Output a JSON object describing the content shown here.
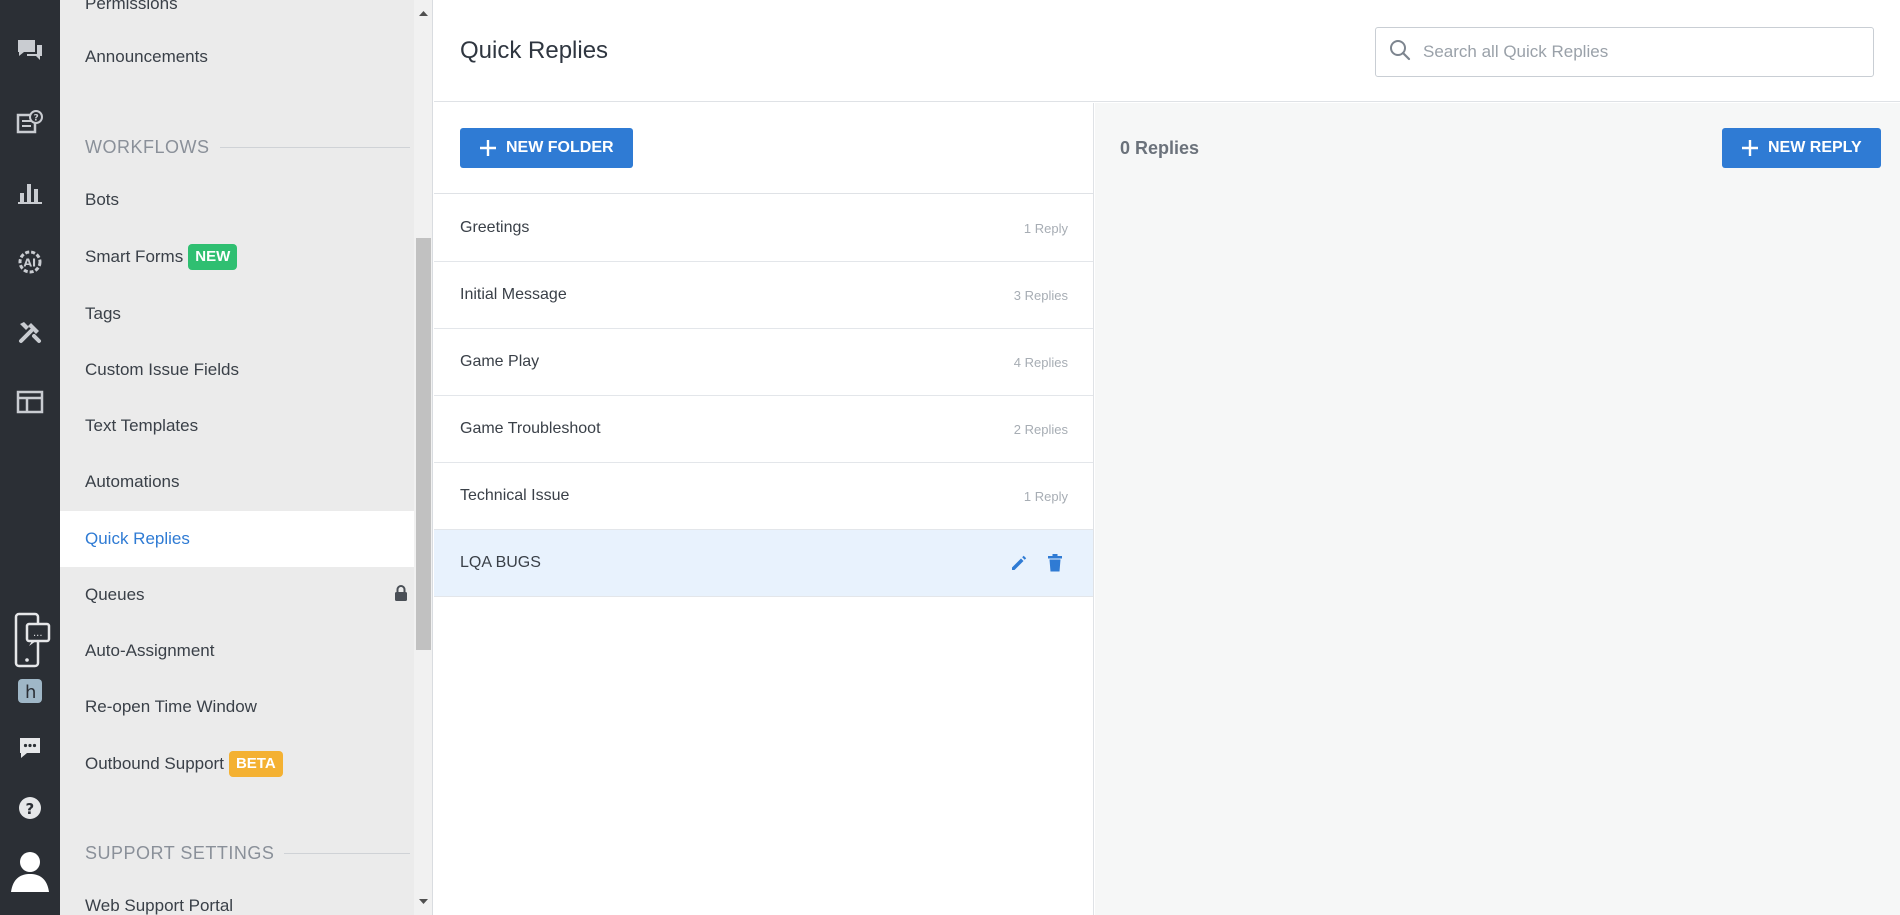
{
  "rail": {
    "icons": [
      "conversations-icon",
      "help-articles-icon",
      "analytics-icon",
      "ai-icon",
      "settings-tools-icon",
      "layout-icon",
      "mobile-chat-icon",
      "helpshift-logo-icon",
      "chat-icon",
      "help-icon",
      "profile-avatar-icon"
    ]
  },
  "sidebar": {
    "top_items": [
      {
        "label": "Permissions"
      },
      {
        "label": "Announcements"
      }
    ],
    "workflows_heading": "WORKFLOWS",
    "items": [
      {
        "label": "Bots"
      },
      {
        "label": "Smart Forms",
        "badge": "NEW"
      },
      {
        "label": "Tags"
      },
      {
        "label": "Custom Issue Fields"
      },
      {
        "label": "Text Templates"
      },
      {
        "label": "Automations"
      },
      {
        "label": "Quick Replies",
        "active": true
      },
      {
        "label": "Queues",
        "locked": true
      },
      {
        "label": "Auto-Assignment"
      },
      {
        "label": "Re-open Time Window"
      },
      {
        "label": "Outbound Support",
        "badge": "BETA"
      }
    ],
    "support_heading": "SUPPORT SETTINGS",
    "bottom_items": [
      {
        "label": "Web Support Portal"
      }
    ]
  },
  "header": {
    "title": "Quick Replies",
    "search_placeholder": "Search all Quick Replies"
  },
  "folders": {
    "new_folder_label": "NEW FOLDER",
    "list": [
      {
        "name": "Greetings",
        "count": "1 Reply"
      },
      {
        "name": "Initial Message",
        "count": "3 Replies"
      },
      {
        "name": "Game Play",
        "count": "4 Replies"
      },
      {
        "name": "Game Troubleshoot",
        "count": "2 Replies"
      },
      {
        "name": "Technical Issue",
        "count": "1 Reply"
      },
      {
        "name": "LQA BUGS",
        "count": "",
        "selected": true
      }
    ]
  },
  "replies": {
    "count_label": "0 Replies",
    "new_reply_label": "NEW REPLY"
  },
  "colors": {
    "accent": "#2f7bd4",
    "rail_bg": "#2b2f35",
    "sidebar_bg": "#ebebeb",
    "badge_new": "#2fbf71",
    "badge_beta": "#f4b132",
    "selected_row": "#e8f2fd"
  }
}
